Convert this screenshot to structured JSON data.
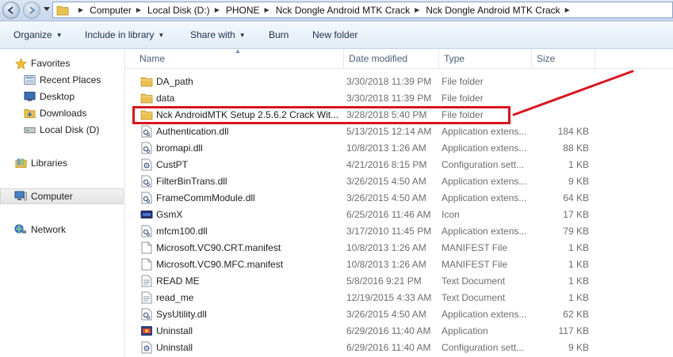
{
  "address": {
    "breadcrumbs": [
      "Computer",
      "Local Disk (D:)",
      "PHONE",
      "Nck Dongle Android MTK Crack",
      "Nck Dongle Android MTK Crack"
    ]
  },
  "toolbar": {
    "organize": "Organize",
    "include": "Include in library",
    "share": "Share with",
    "burn": "Burn",
    "new_folder": "New folder"
  },
  "nav": {
    "favorites": "Favorites",
    "recent": "Recent Places",
    "desktop": "Desktop",
    "downloads": "Downloads",
    "localdisk": "Local Disk (D)",
    "libraries": "Libraries",
    "computer": "Computer",
    "network": "Network"
  },
  "columns": {
    "name": "Name",
    "date": "Date modified",
    "type": "Type",
    "size": "Size"
  },
  "files": [
    {
      "name": "DA_path",
      "date": "3/30/2018 11:39 PM",
      "type": "File folder",
      "size": "",
      "icon": "folder-icon"
    },
    {
      "name": "data",
      "date": "3/30/2018 11:39 PM",
      "type": "File folder",
      "size": "",
      "icon": "folder-icon"
    },
    {
      "name": "Nck AndroidMTK Setup 2.5.6.2 Crack Wit...",
      "date": "3/28/2018 5:40 PM",
      "type": "File folder",
      "size": "",
      "icon": "folder-icon"
    },
    {
      "name": "Authentication.dll",
      "date": "5/13/2015 12:14 AM",
      "type": "Application extens...",
      "size": "184 KB",
      "icon": "dll-icon"
    },
    {
      "name": "bromapi.dll",
      "date": "10/8/2013 1:26 AM",
      "type": "Application extens...",
      "size": "88 KB",
      "icon": "dll-icon"
    },
    {
      "name": "CustPT",
      "date": "4/21/2016 8:15 PM",
      "type": "Configuration sett...",
      "size": "1 KB",
      "icon": "config-icon"
    },
    {
      "name": "FilterBinTrans.dll",
      "date": "3/26/2015 4:50 AM",
      "type": "Application extens...",
      "size": "9 KB",
      "icon": "dll-icon"
    },
    {
      "name": "FrameCommModule.dll",
      "date": "3/26/2015 4:50 AM",
      "type": "Application extens...",
      "size": "64 KB",
      "icon": "dll-icon"
    },
    {
      "name": "GsmX",
      "date": "6/25/2016 11:46 AM",
      "type": "Icon",
      "size": "17 KB",
      "icon": "gsmx-icon"
    },
    {
      "name": "mfcm100.dll",
      "date": "3/17/2010 11:45 PM",
      "type": "Application extens...",
      "size": "79 KB",
      "icon": "dll-icon"
    },
    {
      "name": "Microsoft.VC90.CRT.manifest",
      "date": "10/8/2013 1:26 AM",
      "type": "MANIFEST File",
      "size": "1 KB",
      "icon": "blank-file-icon"
    },
    {
      "name": "Microsoft.VC90.MFC.manifest",
      "date": "10/8/2013 1:26 AM",
      "type": "MANIFEST File",
      "size": "1 KB",
      "icon": "blank-file-icon"
    },
    {
      "name": "READ ME",
      "date": "5/8/2016 9:21 PM",
      "type": "Text Document",
      "size": "1 KB",
      "icon": "text-file-icon"
    },
    {
      "name": "read_me",
      "date": "12/19/2015 4:33 AM",
      "type": "Text Document",
      "size": "1 KB",
      "icon": "text-file-icon"
    },
    {
      "name": "SysUtility.dll",
      "date": "3/26/2015 4:50 AM",
      "type": "Application extens...",
      "size": "62 KB",
      "icon": "dll-icon"
    },
    {
      "name": "Uninstall",
      "date": "6/29/2016 11:40 AM",
      "type": "Application",
      "size": "117 KB",
      "icon": "app-icon"
    },
    {
      "name": "Uninstall",
      "date": "6/29/2016 11:40 AM",
      "type": "Configuration sett...",
      "size": "9 KB",
      "icon": "config-icon"
    }
  ],
  "colors": {
    "highlight": "#d9141f",
    "folder": "#e9c052",
    "header_text": "#4c607a"
  }
}
